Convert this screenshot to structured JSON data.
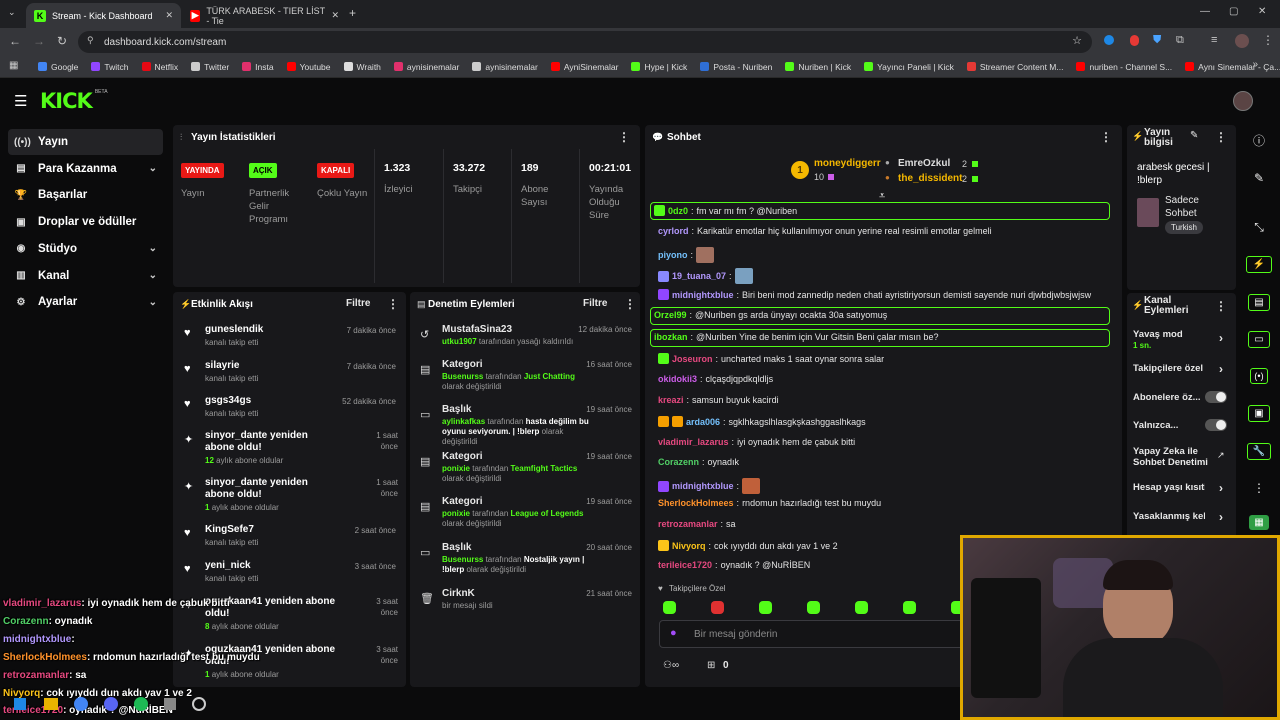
{
  "browser": {
    "tabs": [
      {
        "title": "Stream - Kick Dashboard",
        "active": true
      },
      {
        "title": "TÜRK ARABESK - TIER LİST - Tie",
        "active": false
      }
    ],
    "url": "dashboard.kick.com/stream",
    "bookmarks": [
      {
        "label": "Google",
        "color": "#4285f4"
      },
      {
        "label": "Twitch",
        "color": "#9146ff"
      },
      {
        "label": "Netflix",
        "color": "#e50914"
      },
      {
        "label": "Twitter",
        "color": "#cccccc"
      },
      {
        "label": "Insta",
        "color": "#e1306c"
      },
      {
        "label": "Youtube",
        "color": "#ff0000"
      },
      {
        "label": "Wraith",
        "color": "#dddddd"
      },
      {
        "label": "aynisinemalar",
        "color": "#e1306c"
      },
      {
        "label": "aynisinemalar",
        "color": "#cccccc"
      },
      {
        "label": "AyniSinemalar",
        "color": "#ff0000"
      },
      {
        "label": "Hype | Kick",
        "color": "#53fc18"
      },
      {
        "label": "Posta - Nuriben",
        "color": "#2f6fd6"
      },
      {
        "label": "Nuriben | Kick",
        "color": "#53fc18"
      },
      {
        "label": "Yayıncı Paneli | Kick",
        "color": "#53fc18"
      },
      {
        "label": "Streamer Content M...",
        "color": "#e53935"
      },
      {
        "label": "nuriben - Channel S...",
        "color": "#ff0000"
      },
      {
        "label": "Aynı Sinemalar - Ça...",
        "color": "#ff0000"
      }
    ]
  },
  "logo": {
    "text": "KICK",
    "beta": "BETA"
  },
  "nav": [
    {
      "label": "Yayın",
      "icon": "broadcast-icon",
      "glyph": "((•))",
      "active": true,
      "expand": false
    },
    {
      "label": "Para Kazanma",
      "icon": "money-icon",
      "glyph": "▤",
      "active": false,
      "expand": true
    },
    {
      "label": "Başarılar",
      "icon": "trophy-icon",
      "glyph": "🏆",
      "active": false,
      "expand": false
    },
    {
      "label": "Droplar ve ödüller",
      "icon": "gift-icon",
      "glyph": "▣",
      "active": false,
      "expand": false
    },
    {
      "label": "Stüdyo",
      "icon": "studio-icon",
      "glyph": "◉",
      "active": false,
      "expand": true
    },
    {
      "label": "Kanal",
      "icon": "channel-icon",
      "glyph": "▥",
      "active": false,
      "expand": true
    },
    {
      "label": "Ayarlar",
      "icon": "settings-icon",
      "glyph": "⚙",
      "active": false,
      "expand": true
    }
  ],
  "stats": {
    "title": "Yayın İstatistikleri",
    "items": [
      {
        "badge": "YAYINDA",
        "badge_color": "#e91916",
        "badge_text_color": "#ffffff",
        "label": "Yayın"
      },
      {
        "badge": "AÇIK",
        "badge_color": "#53fc18",
        "badge_text_color": "#000000",
        "label": "Partnerlik Gelir Programı"
      },
      {
        "badge": "KAPALI",
        "badge_color": "#e91916",
        "badge_text_color": "#ffffff",
        "label": "Çoklu Yayın"
      },
      {
        "value": "1.323",
        "label": "İzleyici"
      },
      {
        "value": "33.272",
        "label": "Takipçi"
      },
      {
        "value": "189",
        "label": "Abone Sayısı"
      },
      {
        "value": "00:21:01",
        "label": "Yayında Olduğu Süre"
      }
    ]
  },
  "activity": {
    "title": "Etkinlik Akışı",
    "filter": "Filtre",
    "items": [
      {
        "icon": "heart-icon",
        "name": "guneslendik",
        "sub": "kanalı takip etti",
        "time": "7 dakika önce"
      },
      {
        "icon": "heart-icon",
        "name": "silayrie",
        "sub": "kanalı takip etti",
        "time": "7 dakika önce"
      },
      {
        "icon": "heart-icon",
        "name": "gsgs34gs",
        "sub": "kanalı takip etti",
        "time": "52 dakika önce"
      },
      {
        "icon": "sparkle-icon",
        "name": "sinyor_dante yeniden abone oldu!",
        "sub_num": "12",
        "sub": "aylık abone oldular",
        "time": "1 saat önce"
      },
      {
        "icon": "sparkle-icon",
        "name": "sinyor_dante yeniden abone oldu!",
        "sub_num": "1",
        "sub": "aylık abone oldular",
        "time": "1 saat önce"
      },
      {
        "icon": "heart-icon",
        "name": "KingSefe7",
        "sub": "kanalı takip etti",
        "time": "2 saat önce"
      },
      {
        "icon": "heart-icon",
        "name": "yeni_nick",
        "sub": "kanalı takip etti",
        "time": "3 saat önce"
      },
      {
        "icon": "sparkle-icon",
        "name": "oguzkaan41 yeniden abone oldu!",
        "sub_num": "8",
        "sub": "aylık abone oldular",
        "time": "3 saat önce"
      },
      {
        "icon": "sparkle-icon",
        "name": "oguzkaan41 yeniden abone oldu!",
        "sub_num": "1",
        "sub": "aylık abone oldular",
        "time": "3 saat önce"
      }
    ]
  },
  "moderation": {
    "title": "Denetim Eylemleri",
    "filter": "Filtre",
    "items": [
      {
        "icon": "undo-icon",
        "title": "MustafaSina23",
        "time": "12 dakika önce",
        "parts": [
          {
            "t": "utku1907",
            "g": true
          },
          {
            "t": " tarafından yasağı kaldırıldı",
            "g": false
          }
        ]
      },
      {
        "icon": "category-icon",
        "title": "Kategori",
        "time": "16 saat önce",
        "parts": [
          {
            "t": "Busenurss",
            "g": true
          },
          {
            "t": " tarafından ",
            "g": false
          },
          {
            "t": "Just Chatting",
            "g": true
          },
          {
            "t": " olarak değiştirildi",
            "g": false
          }
        ]
      },
      {
        "icon": "title-icon",
        "title": "Başlık",
        "time": "19 saat önce",
        "parts": [
          {
            "t": "aylinkafkas",
            "g": true
          },
          {
            "t": " tarafından ",
            "g": false
          },
          {
            "t": "hasta değilim bu oyunu seviyorum. | !blerp",
            "w": true
          },
          {
            "t": " olarak değiştirildi",
            "g": false
          }
        ]
      },
      {
        "icon": "category-icon",
        "title": "Kategori",
        "time": "19 saat önce",
        "parts": [
          {
            "t": "ponixie",
            "g": true
          },
          {
            "t": " tarafından ",
            "g": false
          },
          {
            "t": "Teamfight Tactics",
            "g": true
          },
          {
            "t": " olarak değiştirildi",
            "g": false
          }
        ]
      },
      {
        "icon": "category-icon",
        "title": "Kategori",
        "time": "19 saat önce",
        "parts": [
          {
            "t": "ponixie",
            "g": true
          },
          {
            "t": " tarafından ",
            "g": false
          },
          {
            "t": "League of Legends",
            "g": true
          },
          {
            "t": " olarak değiştirildi",
            "g": false
          }
        ]
      },
      {
        "icon": "title-icon",
        "title": "Başlık",
        "time": "20 saat önce",
        "parts": [
          {
            "t": "Busenurss",
            "g": true
          },
          {
            "t": " tarafından ",
            "g": false
          },
          {
            "t": "Nostaljik yayın | !blerp",
            "w": true
          },
          {
            "t": " olarak değiştirildi",
            "g": false
          }
        ]
      },
      {
        "icon": "trash-icon",
        "title": "CirknK",
        "time": "21 saat önce",
        "parts": [
          {
            "t": "bir mesajı sildi",
            "g": false
          }
        ]
      }
    ]
  },
  "chat": {
    "title": "Sohbet",
    "top_gifters": [
      {
        "name": "moneydiggerr",
        "count": "10",
        "rank": "1"
      },
      {
        "name": "EmreOzkul",
        "count": "2"
      },
      {
        "name": "the_dissident",
        "count": "2"
      }
    ],
    "messages": [
      {
        "user": "0dz0",
        "color": "#53fc18",
        "text": "fm var mı fm ? @Nuriben",
        "highlight": true,
        "badges": [
          "#53fc18"
        ]
      },
      {
        "user": "cyrlord",
        "color": "#b197fc",
        "text": "Karikatür emotlar hiç kullanılmıyor onun yerine real resimli emotlar gelmeli"
      },
      {
        "user": "piyono",
        "color": "#74c0fc",
        "text": "",
        "emotes": [
          "#a07060"
        ]
      },
      {
        "user": "19_tuana_07",
        "color": "#b197fc",
        "text": "",
        "badges": [
          "#8888ff"
        ],
        "emotes": [
          "#7aa0c0"
        ]
      },
      {
        "user": "midnightxblue",
        "color": "#b197fc",
        "text": "Biri beni mod zannedip neden chati ayristiriyorsun demisti sayende nuri djwbdjwbsjwjsw",
        "badges": [
          "#9146ff"
        ]
      },
      {
        "user": "Orzel99",
        "color": "#53fc18",
        "text": "@Nuriben gs arda ünyayı ocakta 30a satıyomuş",
        "highlight": true
      },
      {
        "user": "ibozkan",
        "color": "#53fc18",
        "text": "@Nuriben Yine de benim için Vur Gitsin Beni çalar mısın be?",
        "highlight": true
      },
      {
        "user": "Joseuron",
        "color": "#e64980",
        "text": "uncharted maks 1 saat oynar sonra salar",
        "badges": [
          "#53fc18"
        ]
      },
      {
        "user": "okidokii3",
        "color": "#cc5de8",
        "text": "clçaşdjqpdkqldljs"
      },
      {
        "user": "kreazi",
        "color": "#e64980",
        "text": "samsun buyuk kacirdi"
      },
      {
        "user": "arda006",
        "color": "#74c0fc",
        "text": "sgklhkagslhlasgkşkashggaslhkags",
        "badges": [
          "#f59f00",
          "#f59f00"
        ]
      },
      {
        "user": "vladimir_lazarus",
        "color": "#e64980",
        "text": "iyi oynadık hem de çabuk bitti"
      },
      {
        "user": "Corazenn",
        "color": "#51cf66",
        "text": "oynadık"
      },
      {
        "user": "midnightxblue",
        "color": "#b197fc",
        "text": "",
        "badges": [
          "#9146ff"
        ],
        "emotes": [
          "#c0603a"
        ]
      },
      {
        "user": "SherlockHolmees",
        "color": "#ff922b",
        "text": "rndomun hazırladığı test bu muydu"
      },
      {
        "user": "retrozamanlar",
        "color": "#e64980",
        "text": "sa"
      },
      {
        "user": "Nivyorq",
        "color": "#fcc419",
        "text": "cok ıyıyddı dun akdı yav 1 ve 2",
        "badges": [
          "#fcc419"
        ]
      },
      {
        "user": "terileice1720",
        "color": "#e64980",
        "text": "oynadık ? @NuRİBEN"
      }
    ],
    "followers_only": "Takipçilere Özel",
    "input_placeholder": "Bir mesaj gönderin",
    "kicks": "0",
    "emote_icons": [
      "#53fc18",
      "#e03131",
      "#53fc18",
      "#53fc18",
      "#53fc18",
      "#53fc18",
      "#53fc18"
    ]
  },
  "stream_info": {
    "title": "Yayın bilgisi",
    "stream_title": "arabesk gecesi | !blerp",
    "category": "Sadece Sohbet",
    "tag": "Turkish"
  },
  "channel_actions": {
    "title": "Kanal Eylemleri",
    "items": [
      {
        "label": "Yavaş mod",
        "sub": "1 sn.",
        "control": "chevron"
      },
      {
        "label": "Takipçilere özel s",
        "control": "chevron"
      },
      {
        "label": "Abonelere öz...",
        "control": "toggle"
      },
      {
        "label": "Yalnızca...",
        "control": "toggle"
      },
      {
        "label": "Yapay Zeka ile Sohbet Denetimi",
        "control": "external"
      },
      {
        "label": "Hesap yaşı kısıtla",
        "control": "chevron"
      },
      {
        "label": "Yasaklanmış kelin",
        "control": "chevron"
      }
    ]
  },
  "overlay_chat": [
    {
      "user": "vladimir_lazarus",
      "color": "#e64980",
      "text": ": iyi oynadık hem de çabuk bitti"
    },
    {
      "user": "Corazenn",
      "color": "#51cf66",
      "text": ": oynadık"
    },
    {
      "user": "midnightxblue",
      "color": "#b197fc",
      "text": ":"
    },
    {
      "user": "SherlockHolmees",
      "color": "#ff922b",
      "text": ": rndomun hazırladığı test bu muydu"
    },
    {
      "user": "retrozamanlar",
      "color": "#e64980",
      "text": ": sa"
    },
    {
      "user": "Nivyorq",
      "color": "#fcc419",
      "text": ": cok ıyıyddı dun akdı yav 1 ve 2"
    },
    {
      "user": "terileice1720",
      "color": "#e64980",
      "text": ": oynadık ? @NuRİBEN"
    }
  ]
}
